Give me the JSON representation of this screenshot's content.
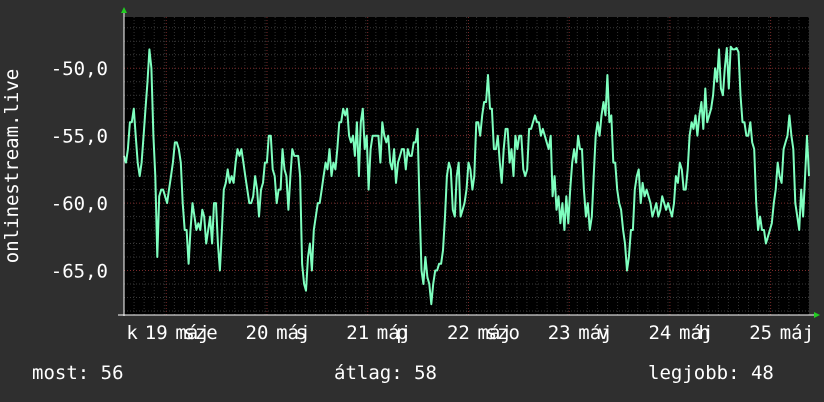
{
  "chart_data": {
    "type": "line",
    "ylabel": "onlinestream.live",
    "ylim": [
      -68.3,
      -46.2
    ],
    "y_ticks": [
      {
        "value": -50,
        "label": "-50,0"
      },
      {
        "value": -55,
        "label": "-55,0"
      },
      {
        "value": -60,
        "label": "-60,0"
      },
      {
        "value": -65,
        "label": "-65,0"
      }
    ],
    "x_range": [
      0,
      340
    ],
    "x_tick_labels": [
      {
        "x": 4,
        "text": "k"
      },
      {
        "x": 16,
        "text": "19"
      },
      {
        "x": 34,
        "text": "máj"
      },
      {
        "x": 38,
        "text": "sze"
      },
      {
        "x": 66,
        "text": "20"
      },
      {
        "x": 84,
        "text": "máj"
      },
      {
        "x": 88,
        "text": "s"
      },
      {
        "x": 116,
        "text": "21"
      },
      {
        "x": 134,
        "text": "máj"
      },
      {
        "x": 138,
        "text": "p"
      },
      {
        "x": 166,
        "text": "22"
      },
      {
        "x": 184,
        "text": "máj"
      },
      {
        "x": 188,
        "text": "szo"
      },
      {
        "x": 216,
        "text": "23"
      },
      {
        "x": 234,
        "text": "máj"
      },
      {
        "x": 238,
        "text": "v"
      },
      {
        "x": 266,
        "text": "24"
      },
      {
        "x": 284,
        "text": "máj"
      },
      {
        "x": 288,
        "text": "h"
      },
      {
        "x": 316,
        "text": "25"
      },
      {
        "x": 334,
        "text": "máj"
      }
    ],
    "grid": true,
    "series": [
      {
        "color": "#7fffbf",
        "values": [
          -56.5,
          -57,
          -56,
          -54,
          -54,
          -53,
          -55,
          -57,
          -58,
          -57,
          -55,
          -53,
          -51,
          -48.6,
          -50,
          -55,
          -58,
          -64,
          -59.5,
          -59,
          -59,
          -59.5,
          -60,
          -59,
          -58,
          -57,
          -55.5,
          -55.5,
          -56,
          -57,
          -60,
          -62,
          -62,
          -64.5,
          -62,
          -60,
          -61,
          -62,
          -61.5,
          -62,
          -60.5,
          -61,
          -63,
          -62,
          -61,
          -63,
          -60,
          -60,
          -63,
          -65,
          -62,
          -59,
          -58.5,
          -57.5,
          -58.5,
          -58,
          -58.5,
          -57,
          -56,
          -56.5,
          -56,
          -57,
          -58,
          -59,
          -60,
          -60,
          -59.5,
          -58,
          -59,
          -61,
          -59,
          -58.5,
          -57,
          -57,
          -55,
          -55,
          -57.5,
          -58,
          -60,
          -59,
          -59,
          -56,
          -57.5,
          -58,
          -60.5,
          -58,
          -56,
          -56.5,
          -56.5,
          -56.5,
          -58,
          -64.5,
          -66,
          -66.5,
          -64,
          -63,
          -65,
          -62,
          -61,
          -60,
          -60,
          -59,
          -58,
          -57,
          -57.5,
          -56,
          -58,
          -57,
          -57.5,
          -56,
          -54,
          -54,
          -53,
          -53.5,
          -53,
          -55,
          -55.5,
          -55,
          -56.5,
          -54,
          -58,
          -54,
          -53,
          -56,
          -55,
          -59,
          -56,
          -55,
          -55,
          -55,
          -55,
          -57,
          -54,
          -55,
          -55.5,
          -55,
          -57,
          -57.5,
          -56,
          -58.5,
          -57,
          -56.5,
          -56,
          -56,
          -57.5,
          -56,
          -56.5,
          -56.5,
          -55.5,
          -55.5,
          -54.5,
          -60,
          -65,
          -66,
          -64,
          -65.5,
          -66,
          -67.5,
          -66,
          -65,
          -65,
          -64.5,
          -64.5,
          -63.5,
          -61,
          -58,
          -57,
          -57.5,
          -60.5,
          -61,
          -58,
          -57,
          -61,
          -60.5,
          -60,
          -59,
          -57,
          -57.5,
          -59,
          -58,
          -54,
          -54,
          -55,
          -53.5,
          -52.5,
          -52.5,
          -50.5,
          -53,
          -53,
          -56,
          -56,
          -55,
          -57,
          -58.5,
          -56,
          -54.5,
          -54.5,
          -57,
          -56,
          -58,
          -55,
          -56,
          -55,
          -55,
          -57.5,
          -58,
          -57.5,
          -54.5,
          -54.5,
          -54,
          -53.5,
          -54,
          -54,
          -55,
          -54.5,
          -55,
          -55.5,
          -56,
          -55,
          -59.5,
          -58,
          -60.5,
          -59.5,
          -61.5,
          -60,
          -62,
          -59.5,
          -61.5,
          -59,
          -57,
          -56,
          -57,
          -55,
          -56,
          -56,
          -59,
          -61,
          -60,
          -62,
          -61,
          -58,
          -55,
          -54,
          -55,
          -53.5,
          -52.5,
          -53.5,
          -50.5,
          -54,
          -53.5,
          -57,
          -57,
          -59,
          -60,
          -60.5,
          -62,
          -63,
          -65,
          -64,
          -62,
          -62,
          -59,
          -58,
          -57.5,
          -60,
          -58.5,
          -59.5,
          -59,
          -59.5,
          -60,
          -61,
          -60.5,
          -60,
          -61,
          -60.5,
          -59.5,
          -60,
          -60.5,
          -60,
          -60.5,
          -61,
          -60,
          -58,
          -58.5,
          -57,
          -57.5,
          -59,
          -59,
          -57.5,
          -55,
          -54,
          -54.5,
          -53.5,
          -55,
          -53.5,
          -52.5,
          -54.5,
          -51.5,
          -54,
          -53.5,
          -53,
          -52,
          -50,
          -51,
          -48.6,
          -51.5,
          -52,
          -50,
          -48.5,
          -51.5,
          -48.4,
          -48.6,
          -48.6,
          -48.5,
          -48.8,
          -52,
          -54,
          -54,
          -55,
          -55,
          -54,
          -55.5,
          -56,
          -60,
          -62,
          -61,
          -62,
          -62,
          -63,
          -62.5,
          -62,
          -61.5,
          -60,
          -59,
          -57,
          -58,
          -58.5,
          -56,
          -55.5,
          -55,
          -53.5,
          -55,
          -56,
          -60,
          -61,
          -62,
          -59,
          -61,
          -58,
          -55,
          -58
        ]
      }
    ]
  },
  "stats": {
    "now": "most: 56",
    "avg": "átlag: 58",
    "best": "legjobb: 48"
  }
}
